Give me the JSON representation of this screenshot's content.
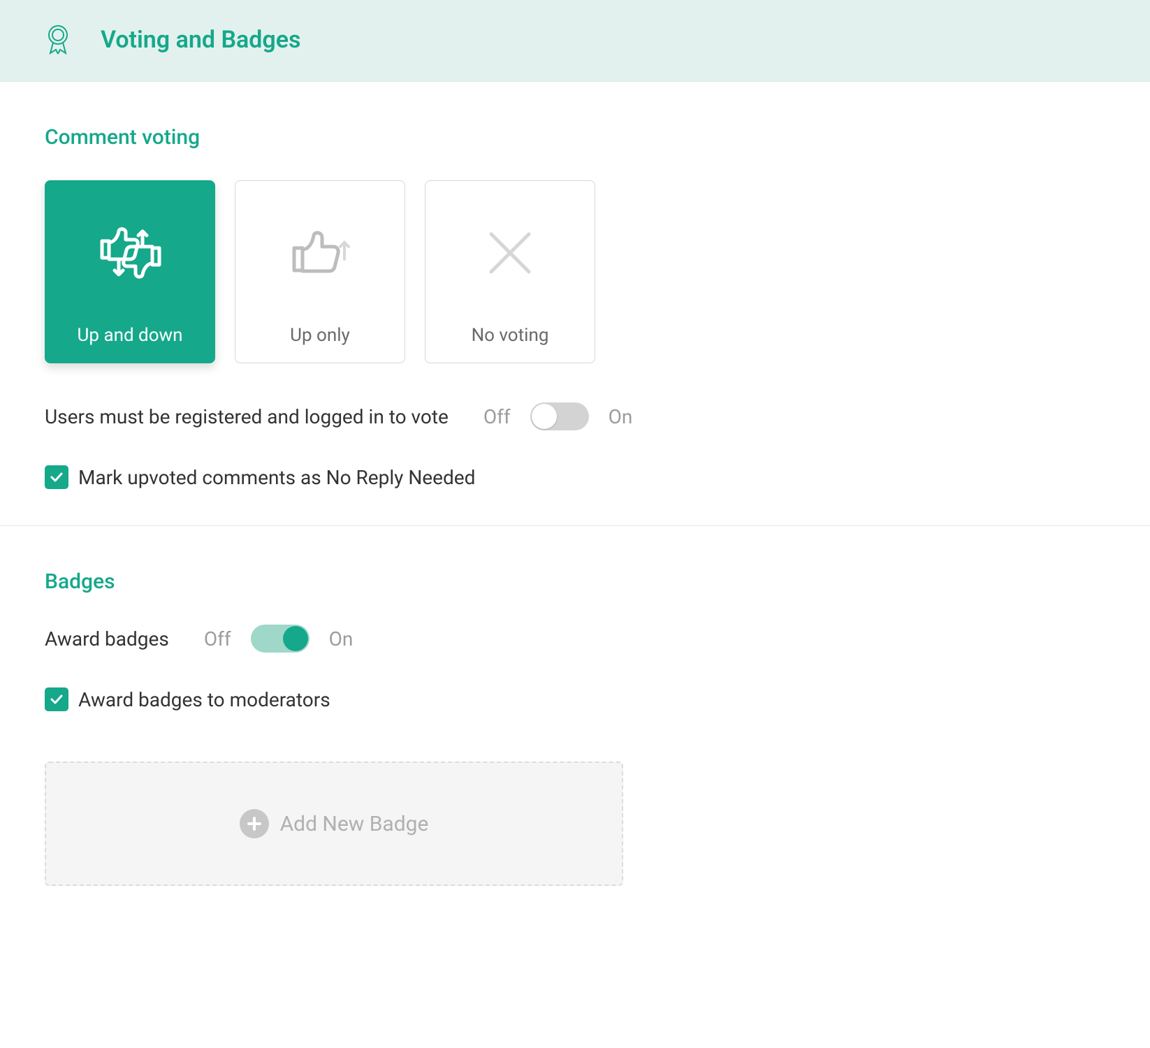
{
  "header": {
    "title": "Voting and Badges"
  },
  "voting": {
    "section_title": "Comment voting",
    "options": {
      "up_down": "Up and down",
      "up_only": "Up only",
      "no_voting": "No voting"
    },
    "login_required_label": "Users must be registered and logged in to vote",
    "login_required_on": false,
    "mark_upvoted_label": "Mark upvoted comments as No Reply Needed",
    "mark_upvoted_checked": true
  },
  "badges": {
    "section_title": "Badges",
    "award_label": "Award badges",
    "award_on": true,
    "award_moderators_label": "Award badges to moderators",
    "award_moderators_checked": true,
    "add_button_label": "Add New Badge"
  },
  "common": {
    "off": "Off",
    "on": "On"
  }
}
